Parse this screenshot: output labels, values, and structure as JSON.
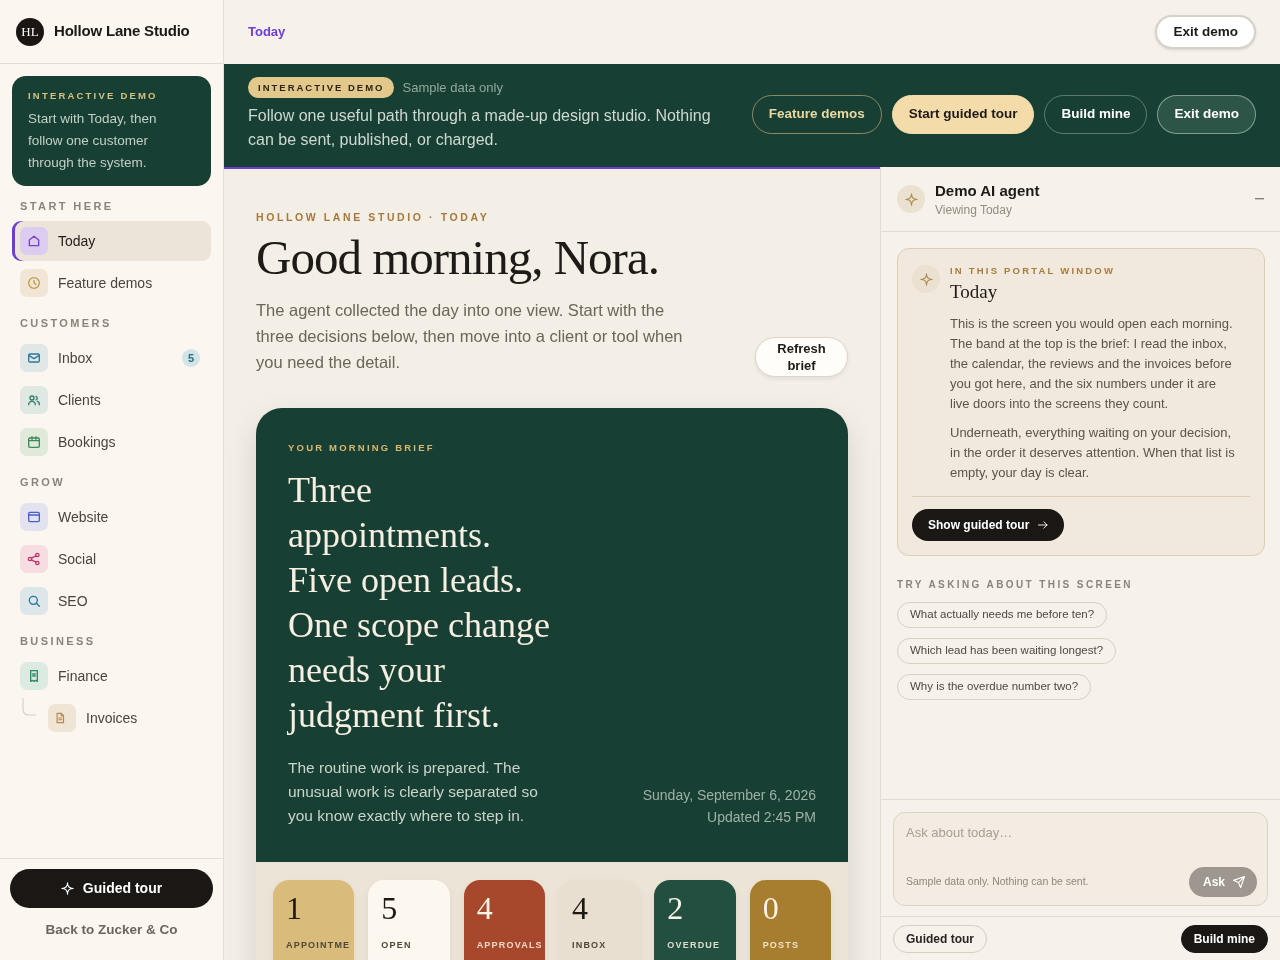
{
  "sidebar": {
    "brand": {
      "monogram": "HL",
      "name": "Hollow Lane Studio"
    },
    "demo_card": {
      "kicker": "INTERACTIVE DEMO",
      "text": "Start with Today, then follow one customer through the system."
    },
    "sections": [
      {
        "title": "START HERE",
        "items": [
          {
            "label": "Today",
            "selected": true
          },
          {
            "label": "Feature demos",
            "selected": false
          }
        ]
      },
      {
        "title": "CUSTOMERS",
        "items": [
          {
            "label": "Inbox",
            "selected": false,
            "badge": "5"
          },
          {
            "label": "Clients",
            "selected": false
          },
          {
            "label": "Bookings",
            "selected": false
          }
        ]
      },
      {
        "title": "GROW",
        "items": [
          {
            "label": "Website",
            "selected": false
          },
          {
            "label": "Social",
            "selected": false
          },
          {
            "label": "SEO",
            "selected": false
          }
        ]
      },
      {
        "title": "BUSINESS",
        "items": [
          {
            "label": "Finance",
            "selected": false,
            "children": [
              {
                "label": "Invoices",
                "selected": false
              }
            ]
          }
        ]
      }
    ],
    "tour_button": "Guided tour",
    "back_link": "Back to Zucker & Co"
  },
  "topbar": {
    "breadcrumb": "Today",
    "exit_button": "Exit demo"
  },
  "demo_band": {
    "badge": "INTERACTIVE DEMO",
    "note": "Sample data only",
    "text": "Follow one useful path through a made-up design studio. Nothing can be sent, published, or charged.",
    "buttons": [
      {
        "label": "Feature demos",
        "kind": "outline"
      },
      {
        "label": "Start guided tour",
        "kind": "primary"
      },
      {
        "label": "Build mine",
        "kind": "ghost"
      },
      {
        "label": "Exit demo",
        "kind": "solid"
      }
    ]
  },
  "today": {
    "kicker": "HOLLOW LANE STUDIO · TODAY",
    "title": "Good morning, Nora.",
    "intro": "The agent collected the day into one view. Start with the three decisions below, then move into a client or tool when you need the detail.",
    "refresh_button": "Refresh brief",
    "brief": {
      "kicker": "YOUR MORNING BRIEF",
      "headline": "Three appointments. Five open leads. One scope change needs your judgment first.",
      "summary": "The routine work is prepared. The unusual work is clearly separated so you know exactly where to step in.",
      "date": "Sunday, September 6, 2026",
      "updated": "Updated 2:45 PM",
      "stats": [
        {
          "value": "1",
          "label": "APPOINTME",
          "color": "#d9bc7b"
        },
        {
          "value": "5",
          "label": "OPEN",
          "color": "#fdf8ef"
        },
        {
          "value": "4",
          "label": "APPROVALS",
          "color": "#a7472c"
        },
        {
          "value": "4",
          "label": "INBOX",
          "color": "#e8dfd1"
        },
        {
          "value": "2",
          "label": "OVERDUE",
          "color": "#234f41"
        },
        {
          "value": "0",
          "label": "POSTS",
          "color": "#a77d2f"
        }
      ]
    }
  },
  "agent_panel": {
    "title": "Demo AI agent",
    "subtitle": "Viewing Today",
    "context_card": {
      "kicker": "IN THIS PORTAL WINDOW",
      "title": "Today",
      "paragraphs": [
        "This is the screen you would open each morning. The band at the top is the brief: I read the inbox, the calendar, the reviews and the invoices before you got here, and the six numbers under it are live doors into the screens they count.",
        "Underneath, everything waiting on your decision, in the order it deserves attention. When that list is empty, your day is clear."
      ],
      "button": "Show guided tour"
    },
    "suggestions": {
      "title": "TRY ASKING ABOUT THIS SCREEN",
      "chips": [
        "What actually needs me before ten?",
        "Which lead has been waiting longest?",
        "Why is the overdue number two?"
      ]
    },
    "composer": {
      "placeholder": "Ask about today…",
      "note": "Sample data only. Nothing can be sent.",
      "button": "Ask"
    },
    "footer_buttons": [
      {
        "label": "Guided tour",
        "kind": "outline"
      },
      {
        "label": "Build mine",
        "kind": "dark"
      }
    ]
  }
}
